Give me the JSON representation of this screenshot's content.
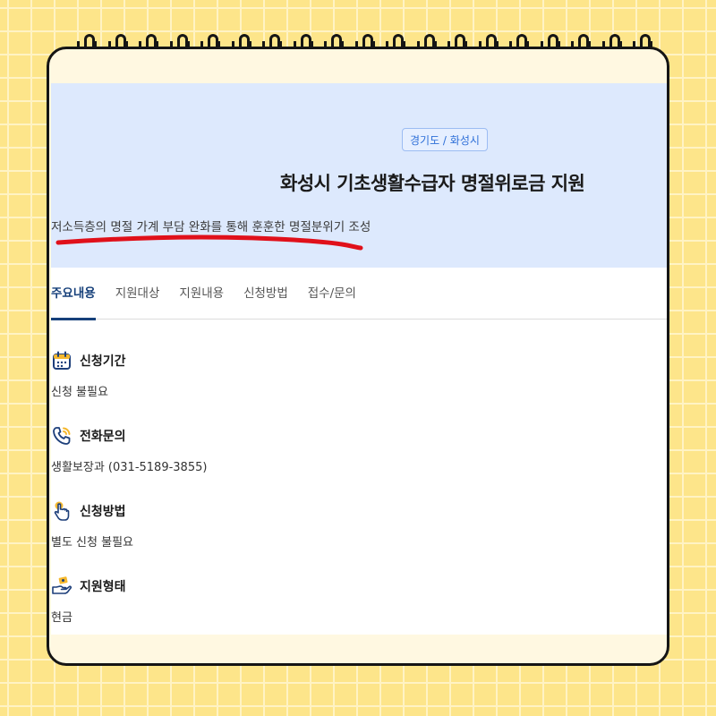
{
  "header": {
    "region_badge": "경기도 / 화성시",
    "title": "화성시 기초생활수급자 명절위로금 지원",
    "subtitle": "저소득층의 명절 가계 부담 완화를 통해 훈훈한 명절분위기 조성"
  },
  "tabs": [
    {
      "label": "주요내용",
      "active": true
    },
    {
      "label": "지원대상",
      "active": false
    },
    {
      "label": "지원내용",
      "active": false
    },
    {
      "label": "신청방법",
      "active": false
    },
    {
      "label": "접수/문의",
      "active": false
    }
  ],
  "info": [
    {
      "icon": "calendar-icon",
      "title": "신청기간",
      "value": "신청 불필요"
    },
    {
      "icon": "phone-icon",
      "title": "전화문의",
      "value": "생활보장과 (031-5189-3855)"
    },
    {
      "icon": "hand-pointer-icon",
      "title": "신청방법",
      "value": "별도 신청 불필요"
    },
    {
      "icon": "money-hand-icon",
      "title": "지원형태",
      "value": "현금"
    }
  ],
  "colors": {
    "background": "#fde58a",
    "hero": "#dde9fd",
    "accent": "#16407a",
    "badge": "#2e6fd8",
    "annotation": "#e0101a"
  }
}
